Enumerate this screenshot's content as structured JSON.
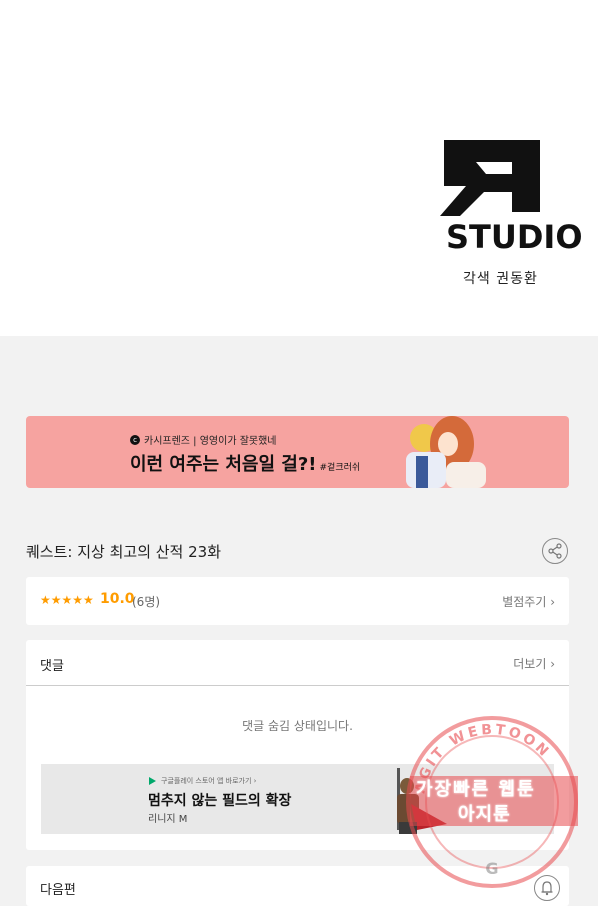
{
  "studio": {
    "logo_text": "STUDIO",
    "credit": "각색 권동환"
  },
  "banner": {
    "sub": "카시프렌즈 | 영영이가 잘못했네",
    "main": "이런 여주는 처음일 걸?!",
    "tag": "#겉크러쉬"
  },
  "episode": {
    "title": "퀘스트: 지상 최고의 산적 23화"
  },
  "rating": {
    "stars": "★★★★★",
    "score": "10.0",
    "count": "(6명)",
    "rate_label": "별점주기 ›"
  },
  "comments": {
    "header": "댓글",
    "more": "더보기 ›",
    "hidden_message": "댓글 숨김 상태입니다."
  },
  "ad": {
    "meta": "구글플레이 스토어 앱 바로가기 ›",
    "headline": "멈추지 않는 필드의 확장",
    "brand": "리니지 M"
  },
  "next": {
    "label": "다음편"
  },
  "watermark": {
    "ring_text": "AGIT WEBTOON",
    "line1": "가장빠른 웹툰",
    "line2": "아지툰"
  },
  "colors": {
    "banner_bg": "#f6a3a0",
    "rating_accent": "#ff9c00",
    "watermark": "#e84a4e"
  }
}
